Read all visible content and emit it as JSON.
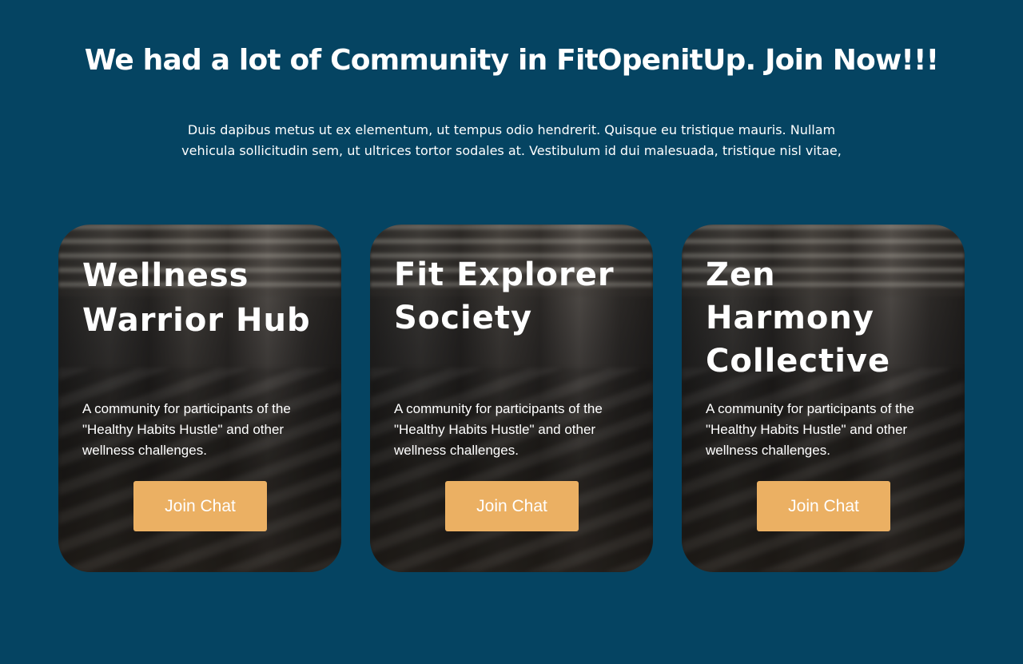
{
  "header": {
    "title": "We had a lot of Community in FitOpenitUp. Join Now!!!",
    "intro": "Duis dapibus metus ut ex elementum, ut tempus odio hendrerit. Quisque eu tristique mauris. Nullam vehicula sollicitudin sem, ut ultrices tortor sodales at. Vestibulum id dui malesuada, tristique nisl vitae,"
  },
  "cards": [
    {
      "title": "Wellness Warrior Hub",
      "description": "A community for participants of the \"Healthy Habits Hustle\" and other wellness challenges.",
      "button_label": "Join Chat"
    },
    {
      "title": "Fit Explorer Society",
      "description": "A community for participants of the \"Healthy Habits Hustle\" and other wellness challenges.",
      "button_label": "Join Chat"
    },
    {
      "title": "Zen Harmony Collective",
      "description": "A community for participants of the \"Healthy Habits Hustle\" and other wellness challenges.",
      "button_label": "Join Chat"
    }
  ],
  "colors": {
    "background": "#054462",
    "button": "#ebb063",
    "text": "#ffffff"
  }
}
